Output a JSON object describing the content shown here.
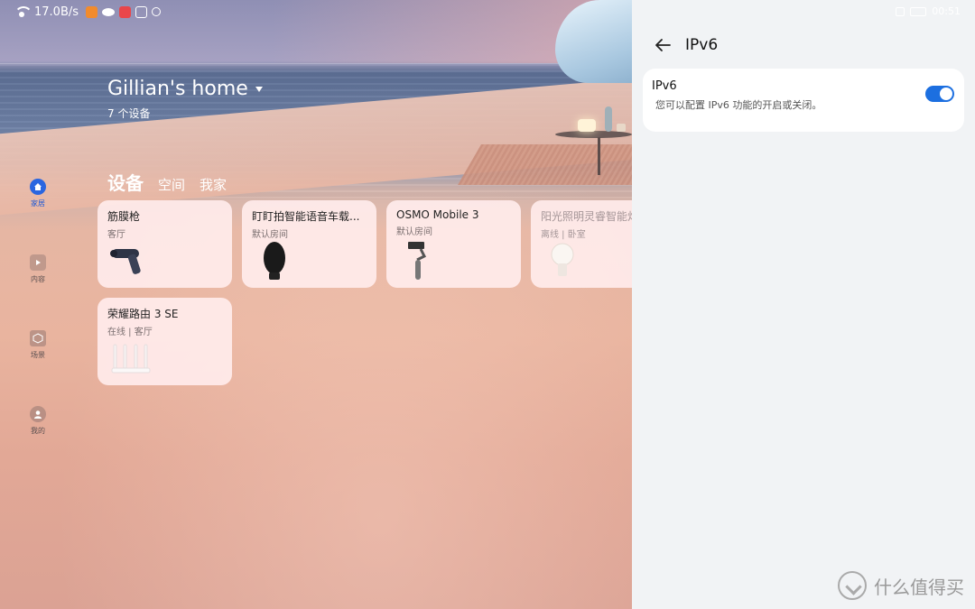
{
  "status_bar": {
    "network_speed": "17.0B/s",
    "time": "00:51",
    "icons": [
      "wifi-icon",
      "video-app-icon",
      "cloud-icon",
      "mail-icon",
      "image-icon",
      "settings-icon"
    ]
  },
  "home": {
    "title": "Gillian's home",
    "device_count": "7 个设备",
    "tabs": [
      {
        "label": "设备",
        "active": true
      },
      {
        "label": "空间",
        "active": false
      },
      {
        "label": "我家",
        "active": false
      }
    ]
  },
  "nav": [
    {
      "label": "家居",
      "icon": "home-icon",
      "active": true
    },
    {
      "label": "内容",
      "icon": "play-icon",
      "active": false
    },
    {
      "label": "场景",
      "icon": "cube-icon",
      "active": false
    },
    {
      "label": "我的",
      "icon": "user-icon",
      "active": false
    }
  ],
  "devices": [
    {
      "name": "筋膜枪",
      "status": "客厅",
      "icon": "massage-gun-icon"
    },
    {
      "name": "盯盯拍智能语音车载...",
      "status": "默认房间",
      "icon": "dashcam-icon"
    },
    {
      "name": "OSMO Mobile 3",
      "status": "默认房间",
      "icon": "gimbal-icon"
    },
    {
      "name": "阳光照明灵睿智能灯",
      "status": "离线 | 卧室",
      "icon": "bulb-icon"
    },
    {
      "name": "荣耀路由 3 SE",
      "status": "在线 | 客厅",
      "icon": "router-icon"
    }
  ],
  "ipv6_panel": {
    "title": "IPv6",
    "setting": {
      "label": "IPv6",
      "description": "您可以配置 IPv6 功能的开启或关闭。",
      "enabled": true
    }
  },
  "watermark": "什么值得买",
  "colors": {
    "accent": "#1c6fe0",
    "panel_bg": "#f1f3f5"
  }
}
